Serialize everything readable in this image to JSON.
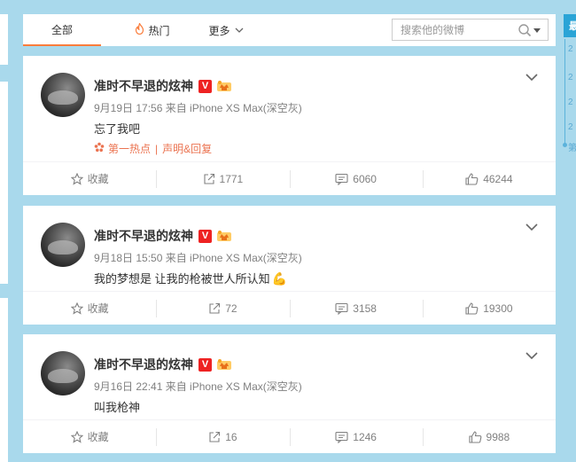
{
  "tabs": {
    "all": "全部",
    "hot": "热门",
    "more": "更多"
  },
  "search": {
    "placeholder": "搜索他的微博"
  },
  "sidebar": {
    "tab_label": "最",
    "timeline": [
      "2",
      "2",
      "2",
      "2",
      "第"
    ]
  },
  "posts": [
    {
      "author": "准时不早退的炫神",
      "vip_badge": "V",
      "time_source": "9月19日 17:56 来自 iPhone XS Max(深空灰)",
      "content": "忘了我吧",
      "hot_label": "第一热点",
      "hot_sep": "|",
      "hot_link": "声明&回复",
      "collect": "收藏",
      "forwards": "1771",
      "comments": "6060",
      "likes": "46244"
    },
    {
      "author": "准时不早退的炫神",
      "vip_badge": "V",
      "time_source": "9月18日 15:50 来自 iPhone XS Max(深空灰)",
      "content": "我的梦想是 让我的枪被世人所认知",
      "content_emoji": "💪",
      "collect": "收藏",
      "forwards": "72",
      "comments": "3158",
      "likes": "19300"
    },
    {
      "author": "准时不早退的炫神",
      "vip_badge": "V",
      "time_source": "9月16日 22:41 来自 iPhone XS Max(深空灰)",
      "content": "叫我枪神",
      "collect": "收藏",
      "forwards": "16",
      "comments": "1246",
      "likes": "9988"
    }
  ],
  "colors": {
    "accent": "#fa7d3c",
    "background": "#a9d9ec",
    "hot": "#eb7350",
    "badge": "#ee2222"
  }
}
